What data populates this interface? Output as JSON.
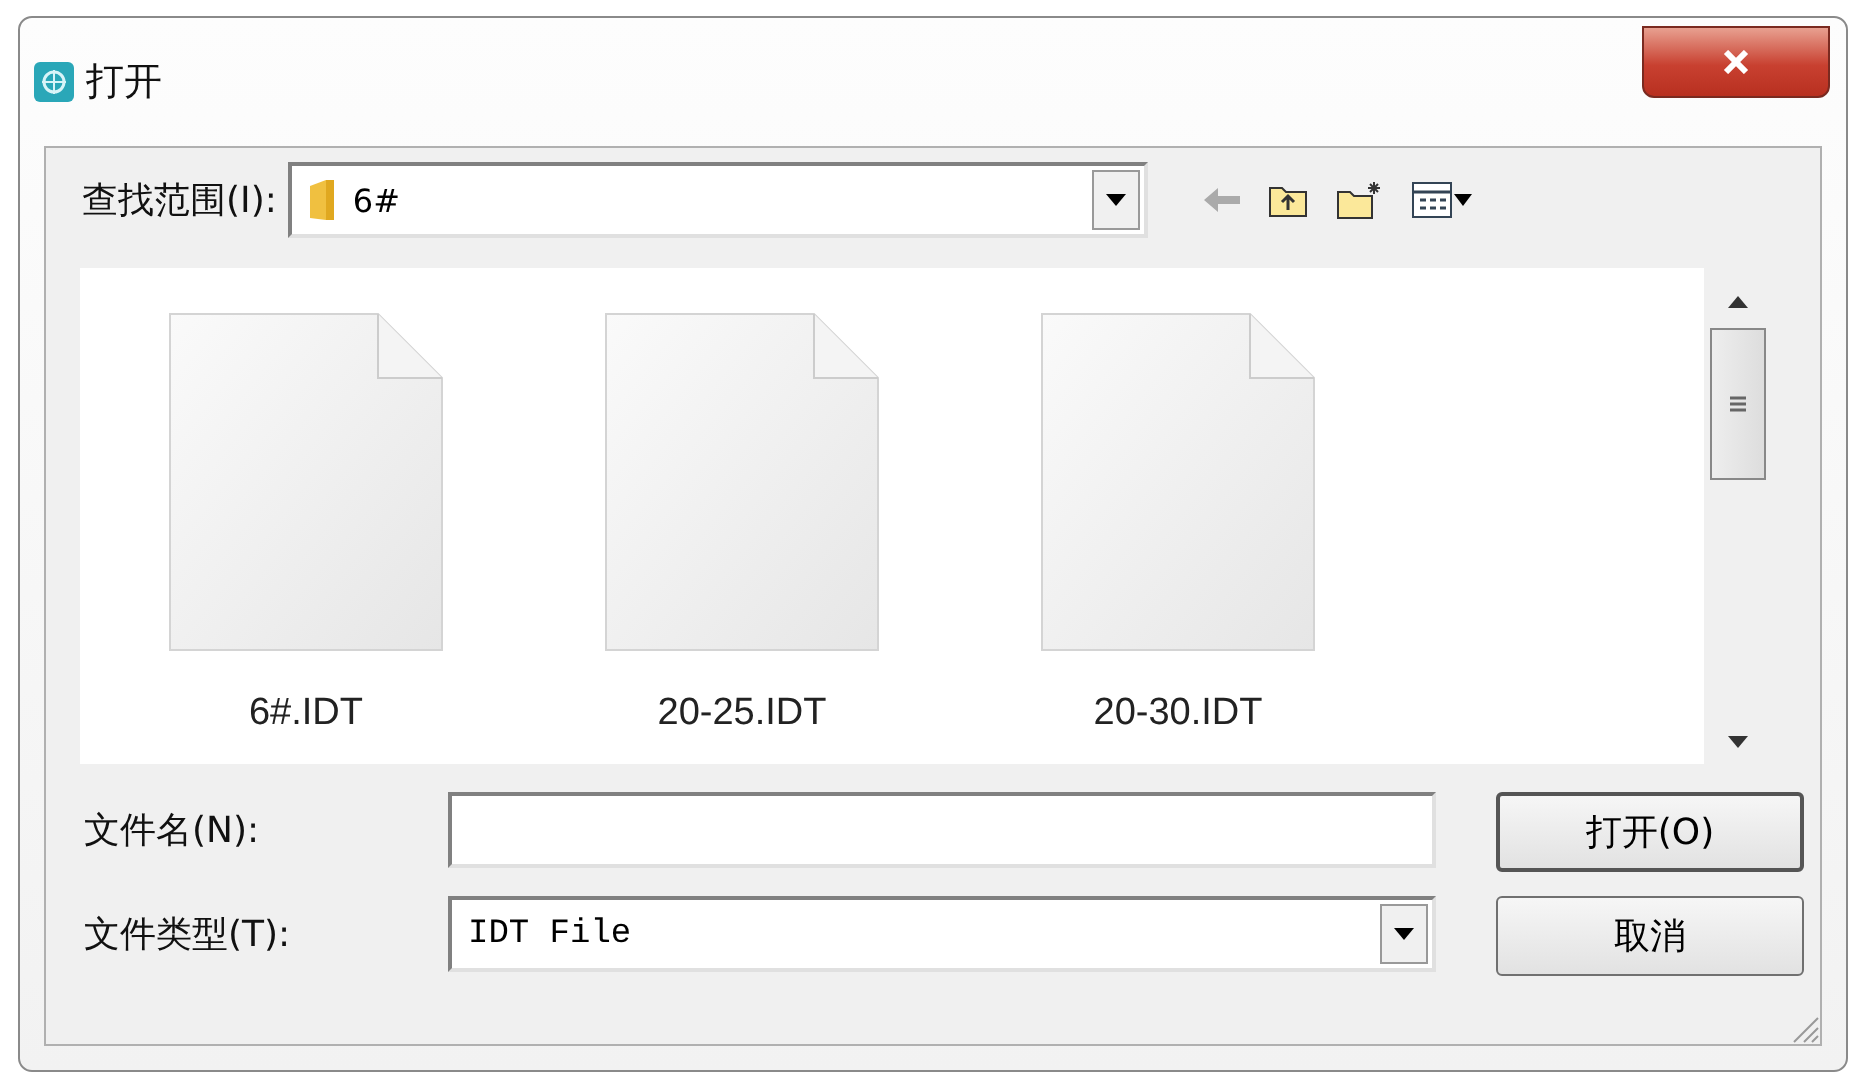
{
  "window": {
    "title": "打开"
  },
  "look_in": {
    "label": "查找范围(I):",
    "value": "6#"
  },
  "files": [
    {
      "name": "6#.IDT"
    },
    {
      "name": "20-25.IDT"
    },
    {
      "name": "20-30.IDT"
    }
  ],
  "file_name": {
    "label": "文件名(N):"
  },
  "file_type": {
    "label": "文件类型(T):",
    "value": "IDT File"
  },
  "buttons": [
    "打开(O)",
    "取消"
  ]
}
